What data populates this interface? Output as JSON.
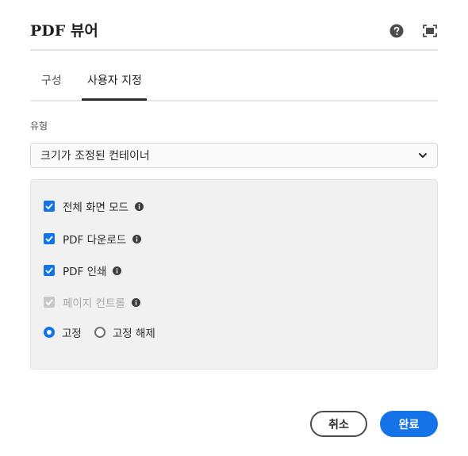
{
  "header": {
    "title_latin": "PDF",
    "title_hangul": "뷰어",
    "help_icon": "help-circle-icon",
    "fullscreen_icon": "fullscreen-icon"
  },
  "tabs": [
    {
      "label": "구성",
      "selected": false
    },
    {
      "label": "사용자 지정",
      "selected": true
    }
  ],
  "type_field": {
    "label": "유형",
    "value": "크기가 조정된 컨테이너"
  },
  "options": [
    {
      "label": "전체 화면 모드",
      "checked": true,
      "disabled": false
    },
    {
      "label": "PDF 다운로드",
      "checked": true,
      "disabled": false
    },
    {
      "label": "PDF 인쇄",
      "checked": true,
      "disabled": false
    },
    {
      "label": "페이지 컨트롤",
      "checked": true,
      "disabled": true
    }
  ],
  "pin": {
    "fixed_label": "고정",
    "unfixed_label": "고정 해제",
    "selected": "fixed"
  },
  "footer": {
    "cancel_label": "취소",
    "done_label": "완료"
  },
  "colors": {
    "accent": "#1473e6",
    "panel_bg": "#f1f1f1",
    "disabled": "#c8c8c8"
  }
}
